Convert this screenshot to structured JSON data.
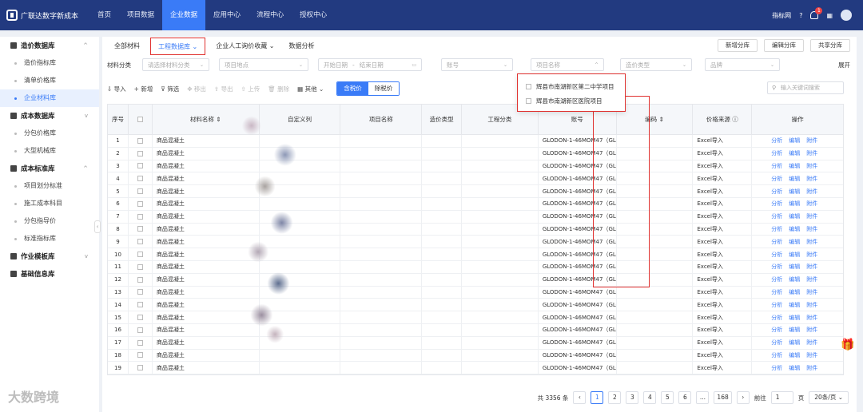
{
  "topbar": {
    "brand": "广联达数字新成本",
    "nav": [
      "首页",
      "项目数据",
      "企业数据",
      "应用中心",
      "流程中心",
      "授权中心"
    ],
    "active": 2,
    "right_label": "指标网"
  },
  "sidebar": {
    "groups": [
      {
        "label": "造价数据库",
        "items": [
          "造价指标库",
          "清单价格库",
          "企业材料库"
        ]
      },
      {
        "label": "成本数据库",
        "items": [
          "分包价格库",
          "大型机械库"
        ]
      },
      {
        "label": "成本标准库",
        "items": [
          "项目划分标准",
          "施工成本科目",
          "分包指导价",
          "标准指标库"
        ]
      },
      {
        "label": "作业模板库",
        "items": []
      },
      {
        "label": "基础信息库",
        "items": []
      }
    ],
    "active_item": "企业材料库"
  },
  "tabs": {
    "items": [
      "全部材料",
      "工程数据库",
      "企业人工询价收藏",
      "数据分析"
    ],
    "buttons": [
      "新增分库",
      "编辑分库",
      "共享分库"
    ]
  },
  "filters": {
    "label": "材料分类",
    "placeholders": [
      "请选择材料分类",
      "项目地点",
      "开始日期",
      "结束日期",
      "账号",
      "项目名称",
      "造价类型",
      "品牌"
    ],
    "expand": "展开"
  },
  "toolbar": {
    "items": [
      "导入",
      "新增",
      "筛选",
      "移出",
      "导出",
      "上传",
      "删除",
      "其他"
    ],
    "tax_on": "含税价",
    "tax_off": "除税价",
    "search_placeholder": "输入关键词搜索"
  },
  "dropdown": {
    "options": [
      "辉县市南湖新区第二中学项目",
      "辉县市南湖新区医院项目"
    ]
  },
  "table": {
    "columns": [
      "序号",
      "",
      "材料名称",
      "自定义列",
      "项目名称",
      "造价类型",
      "工程分类",
      "账号",
      "编码",
      "价格来源",
      "操作"
    ],
    "rows": [
      {
        "no": "1",
        "name": "商品混凝土",
        "account": "GLODON-1-46MOM47（GLO...",
        "source": "Excel导入"
      },
      {
        "no": "2",
        "name": "商品混凝土",
        "account": "GLODON-1-46MOM47（GLO...",
        "source": "Excel导入"
      },
      {
        "no": "3",
        "name": "商品混凝土",
        "account": "GLODON-1-46MOM47（GLO...",
        "source": "Excel导入"
      },
      {
        "no": "4",
        "name": "商品混凝土",
        "account": "GLODON-1-46MOM47（GLO...",
        "source": "Excel导入"
      },
      {
        "no": "5",
        "name": "商品混凝土",
        "account": "GLODON-1-46MOM47（GLO...",
        "source": "Excel导入"
      },
      {
        "no": "6",
        "name": "商品混凝土",
        "account": "GLODON-1-46MOM47（GLO...",
        "source": "Excel导入"
      },
      {
        "no": "7",
        "name": "商品混凝土",
        "account": "GLODON-1-46MOM47（GLO...",
        "source": "Excel导入"
      },
      {
        "no": "8",
        "name": "商品混凝土",
        "account": "GLODON-1-46MOM47（GLO...",
        "source": "Excel导入"
      },
      {
        "no": "9",
        "name": "商品混凝土",
        "account": "GLODON-1-46MOM47（GLO...",
        "source": "Excel导入"
      },
      {
        "no": "10",
        "name": "商品混凝土",
        "account": "GLODON-1-46MOM47（GLO...",
        "source": "Excel导入"
      },
      {
        "no": "11",
        "name": "商品混凝土",
        "account": "GLODON-1-46MOM47（GLO...",
        "source": "Excel导入"
      },
      {
        "no": "12",
        "name": "商品混凝土",
        "account": "GLODON-1-46MOM47（GLO...",
        "source": "Excel导入"
      },
      {
        "no": "13",
        "name": "商品混凝土",
        "account": "GLODON-1-46MOM47（GLO...",
        "source": "Excel导入"
      },
      {
        "no": "14",
        "name": "商品混凝土",
        "account": "GLODON-1-46MOM47（GLO...",
        "source": "Excel导入"
      },
      {
        "no": "15",
        "name": "商品混凝土",
        "account": "GLODON-1-46MOM47（GLO...",
        "source": "Excel导入"
      },
      {
        "no": "16",
        "name": "商品混凝土",
        "account": "GLODON-1-46MOM47（GLO...",
        "source": "Excel导入"
      },
      {
        "no": "17",
        "name": "商品混凝土",
        "account": "GLODON-1-46MOM47（GLO...",
        "source": "Excel导入"
      },
      {
        "no": "18",
        "name": "商品混凝土",
        "account": "GLODON-1-46MOM47（GLO...",
        "source": "Excel导入"
      },
      {
        "no": "19",
        "name": "商品混凝土",
        "account": "GLODON-1-46MOM47（GLO...",
        "source": "Excel导入"
      }
    ],
    "ops": [
      "分析",
      "编辑",
      "附件"
    ]
  },
  "pager": {
    "total": "共 3356 条",
    "pages": [
      "1",
      "2",
      "3",
      "4",
      "5",
      "6",
      "...",
      "168"
    ],
    "goto": "前往",
    "page_value": "1",
    "page_suffix": "页",
    "size": "20条/页"
  },
  "watermark": "大数跨境",
  "colors": {
    "nav_bg": "#223a80",
    "accent": "#3a7bf7",
    "highlight": "#e0312f"
  }
}
